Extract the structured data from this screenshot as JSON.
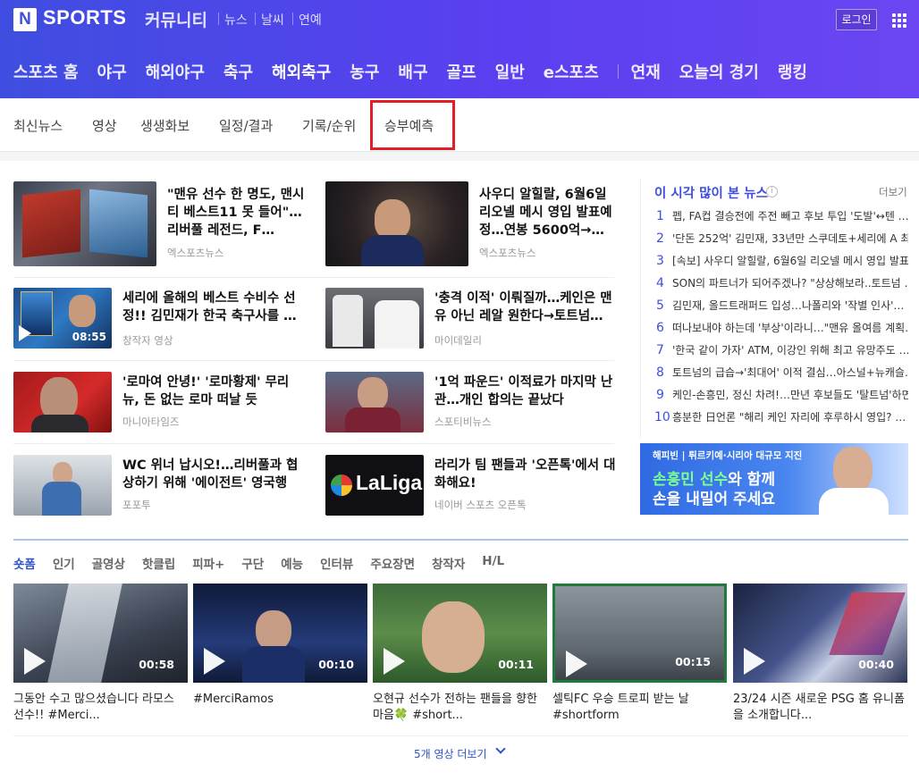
{
  "header": {
    "logo_letter": "N",
    "brand": "SPORTS",
    "community": "커뮤니티",
    "services": [
      "뉴스",
      "날씨",
      "연예"
    ],
    "login": "로그인"
  },
  "main_nav": [
    "스포츠 홈",
    "야구",
    "해외야구",
    "축구",
    "해외축구",
    "농구",
    "배구",
    "골프",
    "일반",
    "e스포츠",
    "연재",
    "오늘의 경기",
    "랭킹"
  ],
  "main_nav_active": "해외축구",
  "sub_nav": [
    "최신뉴스",
    "영상",
    "생생화보",
    "일정/결과",
    "기록/순위",
    "승부예측"
  ],
  "news": [
    {
      "title": "\"맨유 선수 한 명도, 맨시티 베스트11 못 들어\"…리버풀 레전드, F…",
      "source": "엑스포츠뉴스"
    },
    {
      "title": "사우디 알힐랄, 6월6일 리오넬 메시 영입 발표예정…연봉 5600억→…",
      "source": "엑스포츠뉴스"
    },
    {
      "title": "세리에 올해의 베스트 수비수 선정!! 김민재가 한국 축구사를 …",
      "source": "창작자 영상",
      "duration": "08:55"
    },
    {
      "title": "'충격 이적' 이뤄질까…케인은 맨유 아닌 레알 원한다→토트넘…",
      "source": "마이데일리"
    },
    {
      "title": "'로마여 안녕!' '로마황제' 무리뉴, 돈 없는 로마 떠날 듯",
      "source": "마니아타임즈"
    },
    {
      "title": "'1억 파운드' 이적료가 마지막 난관…개인 합의는 끝났다",
      "source": "스포티비뉴스"
    },
    {
      "title": "WC 위너 납시오!…리버풀과 협상하기 위해 '에이전트' 영국행",
      "source": "포포투"
    },
    {
      "title": "라리가 팀 팬들과 '오픈톡'에서 대화해요!",
      "source": "네이버 스포츠 오픈톡",
      "logo_text": "LaLiga"
    }
  ],
  "ranking": {
    "title": "이 시각 많이 본 뉴스",
    "more": "더보기",
    "items": [
      "펩, FA컵 결승전에 주전 빼고 후보 투입 '도발'↔텐 …",
      "'단돈 252억' 김민재, 33년만 스쿠데토+세리에 A 최…",
      "[속보] 사우디 알힐랄, 6월6일 리오넬 메시 영입 발표…",
      "SON의 파트너가 되어주겠나? \"상상해보라..토트넘 …",
      "김민재, 올드트래퍼드 입성…나폴리와 '작별 인사'…",
      "떠나보내야 하는데 '부상'이라니…\"맨유 올여름 계획…",
      "'한국 같이 가자' ATM, 이강인 위해 최고 유망주도 …",
      "토트넘의 급습→'최대어' 이적 결심…아스널+뉴캐슬…",
      "케인-손흥민, 정신 차려!…만년 후보들도 '탈트넘'하면…",
      "흥분한 日언론 \"해리 케인 자리에 후루하시 영입? …"
    ]
  },
  "banner": {
    "line1": "해피빈 | 튀르키예·시리아 대규모 지진",
    "line2a": "손흥민 선수",
    "line2b": "와 함께",
    "line3": "손을 내밀어 주세요"
  },
  "shortform": {
    "tabs": [
      "숏폼",
      "인기",
      "골영상",
      "핫클립",
      "피파+",
      "구단",
      "예능",
      "인터뷰",
      "주요장면",
      "창작자",
      "H/L"
    ],
    "clips": [
      {
        "duration": "00:58",
        "caption": "그동안 수고 많으셨습니다 라모스 선수!! #Merci..."
      },
      {
        "duration": "00:10",
        "caption": "#MerciRamos"
      },
      {
        "duration": "00:11",
        "caption": "오현규 선수가 전하는 팬들을 향한 마음🍀 #short..."
      },
      {
        "duration": "00:15",
        "caption": "셀틱FC 우승 트로피 받는 날 #shortform"
      },
      {
        "duration": "00:40",
        "caption": "23/24 시즌 새로운 PSG 홈 유니폼을 소개합니다..."
      }
    ],
    "more": "5개 영상 더보기"
  }
}
